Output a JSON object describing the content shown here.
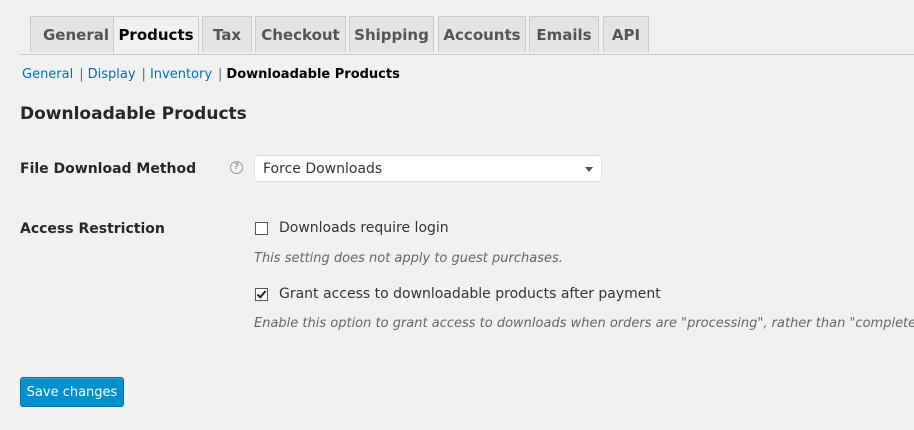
{
  "tabs": [
    {
      "label": "General"
    },
    {
      "label": "Products"
    },
    {
      "label": "Tax"
    },
    {
      "label": "Checkout"
    },
    {
      "label": "Shipping"
    },
    {
      "label": "Accounts"
    },
    {
      "label": "Emails"
    },
    {
      "label": "API"
    }
  ],
  "active_tab": "Products",
  "subnav": {
    "general": "General",
    "display": "Display",
    "inventory": "Inventory",
    "current": "Downloadable Products",
    "separator": "|"
  },
  "section_title": "Downloadable Products",
  "file_download_method": {
    "label": "File Download Method",
    "help_glyph": "?",
    "selected": "Force Downloads"
  },
  "access_restriction": {
    "label": "Access Restriction",
    "options": [
      {
        "label": "Downloads require login",
        "checked": false,
        "description": "This setting does not apply to guest purchases."
      },
      {
        "label": "Grant access to downloadable products after payment",
        "checked": true,
        "description": "Enable this option to grant access to downloads when orders are \"processing\", rather than \"completed\"."
      }
    ]
  },
  "save_label": "Save changes",
  "colors": {
    "accent": "#0091cd",
    "link": "#0073aa",
    "background": "#f1f1f1"
  }
}
